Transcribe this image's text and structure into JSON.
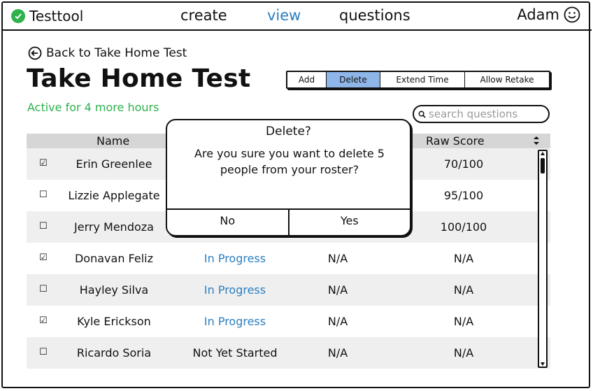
{
  "app": {
    "name": "Testtool",
    "user": "Adam"
  },
  "nav": {
    "create": "create",
    "view": "view",
    "questions": "questions"
  },
  "page": {
    "back_label": "Back to Take Home Test",
    "title": "Take Home Test",
    "status": "Active for 4 more hours"
  },
  "toolbar": {
    "add": "Add",
    "delete": "Delete",
    "extend": "Extend Time",
    "retake": "Allow Retake"
  },
  "search": {
    "placeholder": "search questions"
  },
  "table": {
    "headers": {
      "name": "Name",
      "score": "Raw Score"
    },
    "rows": [
      {
        "checked": true,
        "name": "Erin Greenlee",
        "status": "",
        "time": "",
        "score": "70/100"
      },
      {
        "checked": false,
        "name": "Lizzie Applegate",
        "status": "",
        "time": "",
        "score": "95/100"
      },
      {
        "checked": false,
        "name": "Jerry Mendoza",
        "status": "",
        "time": "",
        "score": "100/100"
      },
      {
        "checked": true,
        "name": "Donavan Feliz",
        "status": "In Progress",
        "time": "N/A",
        "score": "N/A"
      },
      {
        "checked": false,
        "name": "Hayley Silva",
        "status": "In Progress",
        "time": "N/A",
        "score": "N/A"
      },
      {
        "checked": true,
        "name": "Kyle Erickson",
        "status": "In Progress",
        "time": "N/A",
        "score": "N/A"
      },
      {
        "checked": false,
        "name": "Ricardo Soria",
        "status": "Not Yet Started",
        "time": "N/A",
        "score": "N/A"
      }
    ]
  },
  "modal": {
    "title": "Delete?",
    "message": "Are you sure you want to delete 5 people from your roster?",
    "no": "No",
    "yes": "Yes"
  },
  "colors": {
    "accent": "#2b7fc0",
    "success": "#2fb14b",
    "selected": "#8fb6e8"
  }
}
